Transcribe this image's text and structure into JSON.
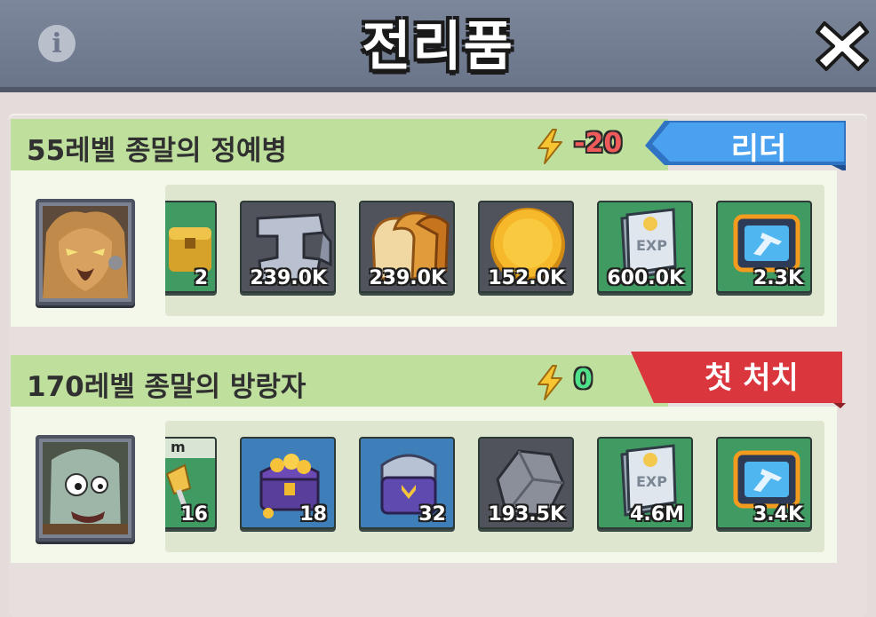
{
  "header": {
    "title": "전리품",
    "info_icon": "info-icon",
    "close_icon": "close-icon"
  },
  "colors": {
    "header_bg": "#737d91",
    "name_bar": "#bfe09d",
    "ribbon_leader": "#3e97e6",
    "ribbon_first_kill": "#d9363e",
    "item_green": "#3f9b62",
    "item_blue": "#3f7fb9",
    "item_gray": "#4e525a"
  },
  "sections": [
    {
      "name": "55레벨 종말의 정예병",
      "power": "-20",
      "ribbon": "리더",
      "portrait_icon": "lion-warrior-portrait",
      "rewards": [
        {
          "icon": "golden-chest-icon",
          "qty": "2"
        },
        {
          "icon": "steel-ingot-icon",
          "qty": "239.0K"
        },
        {
          "icon": "bread-icon",
          "qty": "239.0K"
        },
        {
          "icon": "gold-coin-icon",
          "qty": "152.0K"
        },
        {
          "icon": "exp-book-icon",
          "qty": "600.0K"
        },
        {
          "icon": "jet-card-icon",
          "qty": "2.3K"
        }
      ]
    },
    {
      "name": "170레벨 종말의 방랑자",
      "power": "0",
      "ribbon": "첫 처치",
      "portrait_icon": "zombie-portrait",
      "rewards": [
        {
          "icon": "gold-shovel-icon",
          "qty": "16",
          "tag": "m"
        },
        {
          "icon": "gold-treasure-chest-icon",
          "qty": "18"
        },
        {
          "icon": "rank-chest-icon",
          "qty": "32"
        },
        {
          "icon": "iron-ore-icon",
          "qty": "193.5K"
        },
        {
          "icon": "exp-book-icon",
          "qty": "4.6M"
        },
        {
          "icon": "jet-card-icon",
          "qty": "3.4K"
        }
      ]
    }
  ]
}
